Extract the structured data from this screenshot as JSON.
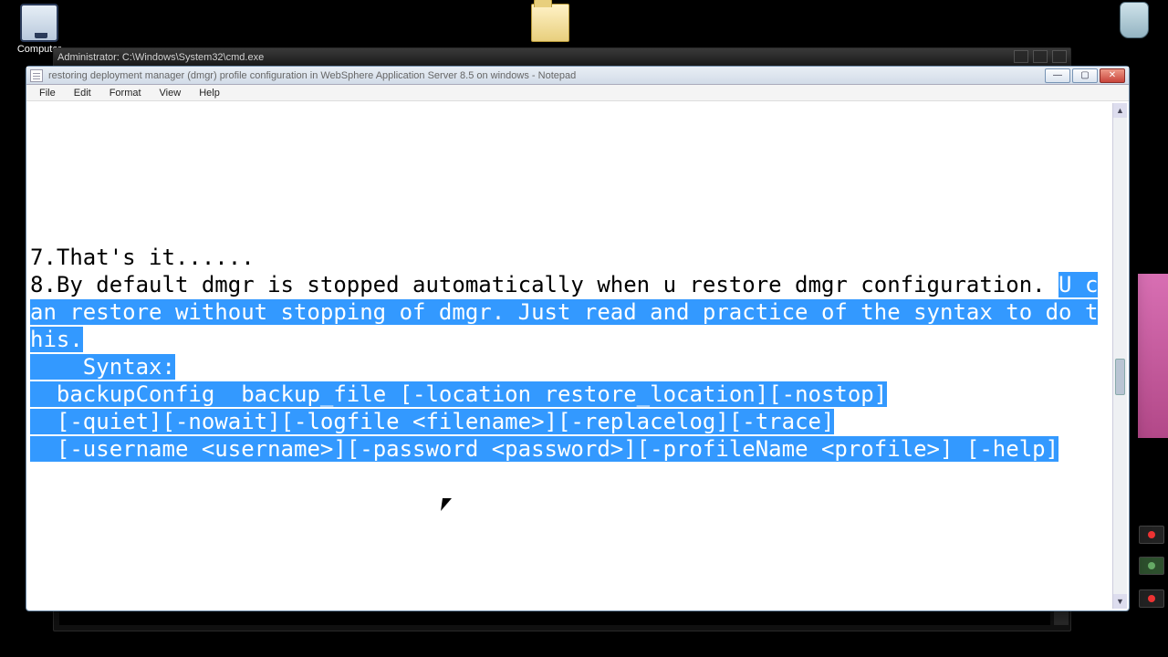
{
  "desktop": {
    "computer_label": "Computer"
  },
  "cmd": {
    "title": "Administrator: C:\\Windows\\System32\\cmd.exe"
  },
  "notepad": {
    "title": "restoring  deployment manager (dmgr) profile configuration in WebSphere Application Server  8.5 on windows - Notepad",
    "menus": {
      "file": "File",
      "edit": "Edit",
      "format": "Format",
      "view": "View",
      "help": "Help"
    },
    "win_btns": {
      "min": "—",
      "max": "▢",
      "close": "✕"
    },
    "scroll": {
      "up": "▲",
      "down": "▼"
    },
    "content": {
      "plain_before": "7.That's it......\n8.By default dmgr is stopped automatically when u restore dmgr configuration. ",
      "selected": "U can restore without stopping of dmgr. Just read and practice of the syntax to do this.\n    Syntax:\n  backupConfig  backup_file [-location restore_location][-nostop]\n  [-quiet][-nowait][-logfile <filename>][-replacelog][-trace]\n  [-username <username>][-password <password>][-profileName <profile>] [-help]",
      "plain_after": ""
    }
  }
}
